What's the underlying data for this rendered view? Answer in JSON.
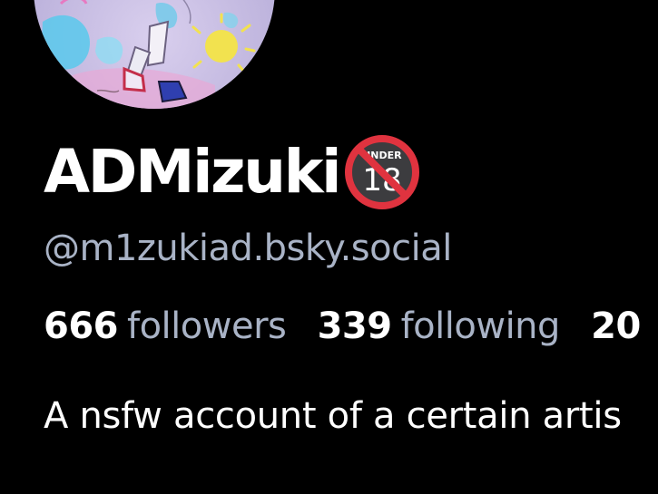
{
  "profile": {
    "display_name": "ADMizuki",
    "badge_icon": "under-18-prohibited-icon",
    "badge_text": "UNDER",
    "badge_number": "18",
    "handle": "@m1zukiad.bsky.social",
    "avatar_icon": "profile-avatar-illustration"
  },
  "stats": {
    "followers": {
      "count": "666",
      "label": "followers"
    },
    "following": {
      "count": "339",
      "label": "following"
    },
    "posts_partial": {
      "count": "20"
    }
  },
  "bio": "A nsfw account of a certain artis",
  "colors": {
    "background": "#000000",
    "primary_text": "#ffffff",
    "secondary_text": "#a9b3c6",
    "badge_red": "#e0333f"
  }
}
